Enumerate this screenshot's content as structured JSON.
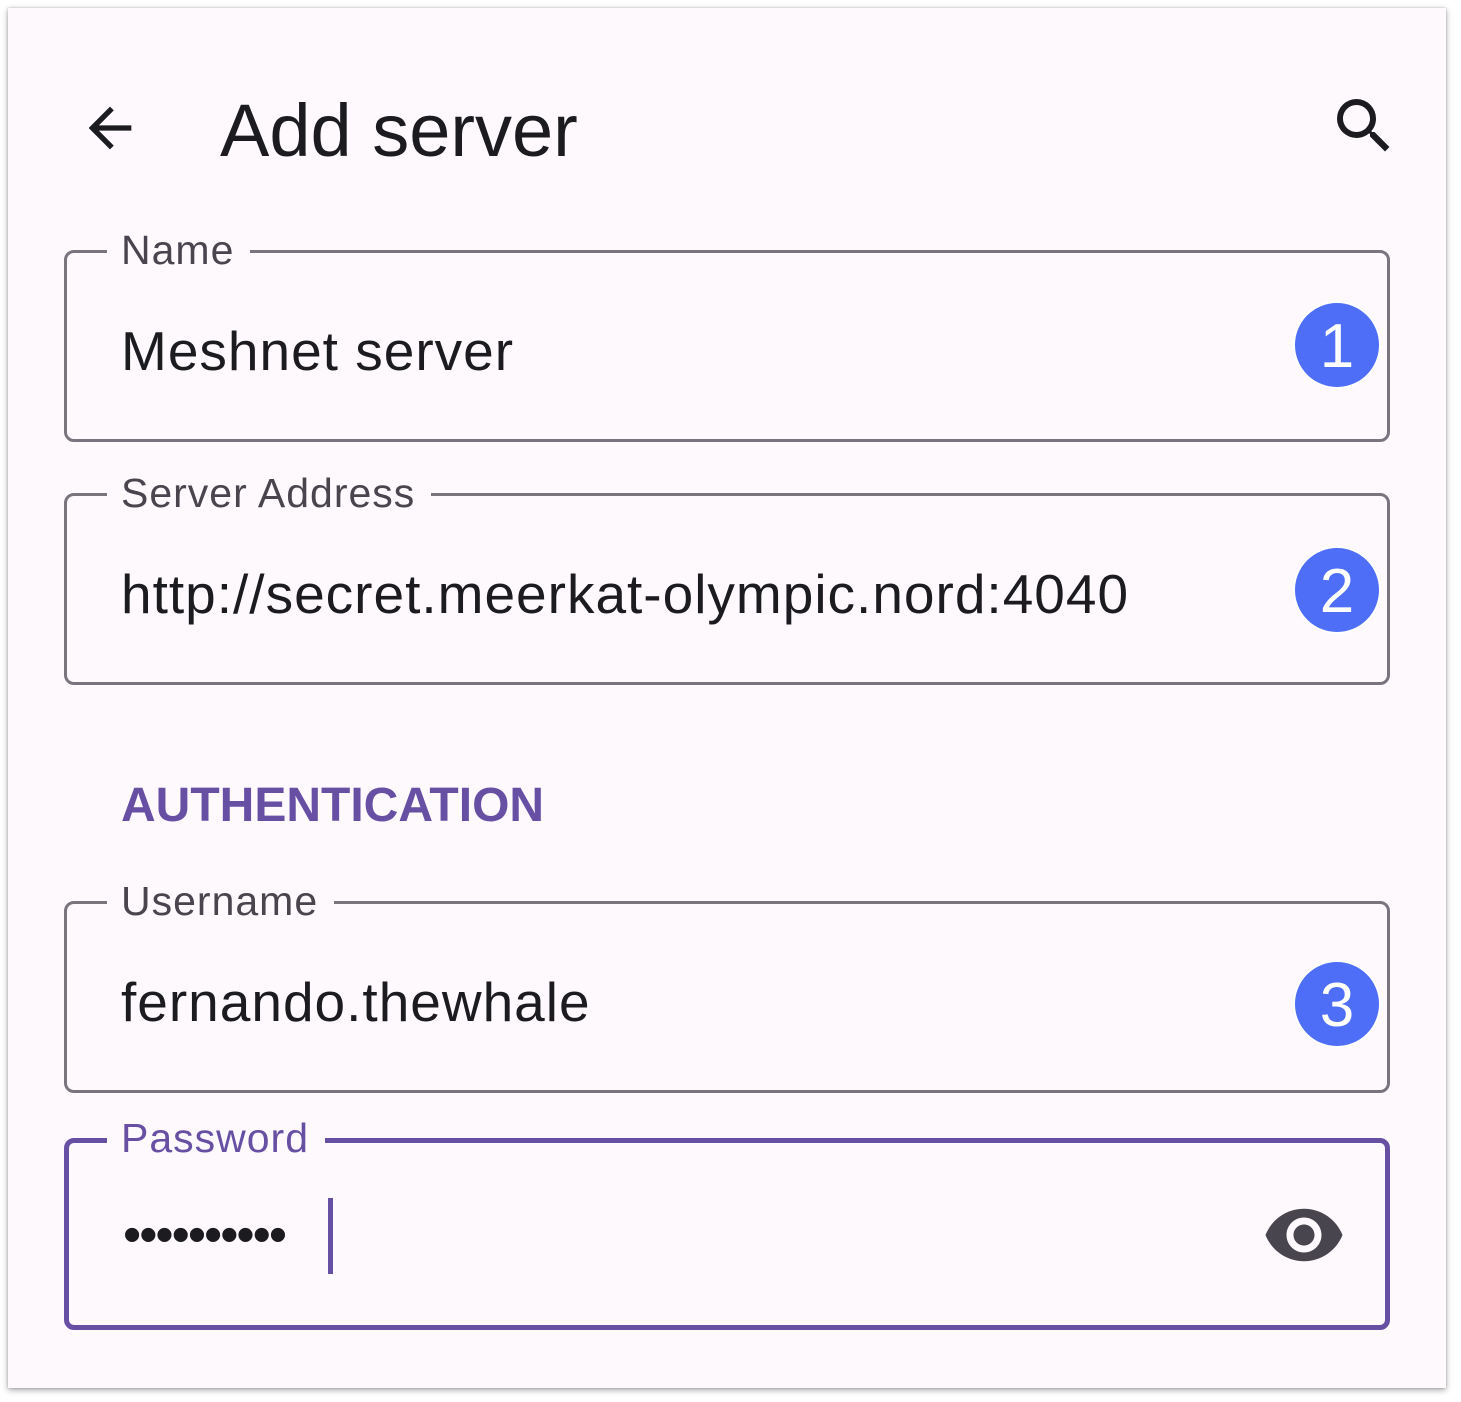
{
  "appbar": {
    "title": "Add server",
    "back_icon": "arrow-back-icon",
    "search_icon": "search-icon"
  },
  "fields": {
    "name": {
      "label": "Name",
      "value": "Meshnet server",
      "badge": "1"
    },
    "address": {
      "label": "Server Address",
      "value": "http://secret.meerkat-olympic.nord:4040",
      "badge": "2"
    },
    "username": {
      "label": "Username",
      "value": "fernando.thewhale",
      "badge": "3"
    },
    "password": {
      "label": "Password",
      "value": "••••••••••",
      "toggle_icon": "eye-icon"
    }
  },
  "section": {
    "authentication": "AUTHENTICATION"
  },
  "colors": {
    "primary": "#6750a4",
    "badge": "#4f6ef7",
    "outline": "#79747e",
    "surface": "#fdf9fd"
  }
}
